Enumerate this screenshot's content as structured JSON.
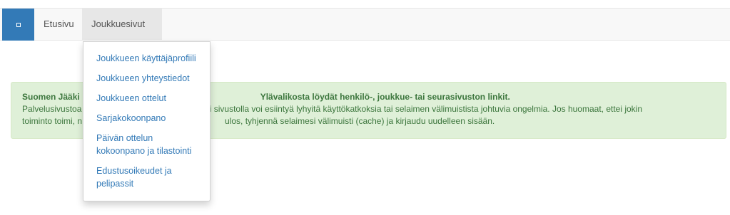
{
  "navbar": {
    "brand_icon": "square-icon",
    "home_label": "Etusivu",
    "team_label": "Joukkuesivut"
  },
  "dropdown": {
    "items": [
      "Joukkueen käyttäjäprofiili",
      "Joukkueen yhteystiedot",
      "Joukkueen ottelut",
      "Sarjakokoonpano",
      "Päivän ottelun kokoonpano ja tilastointi",
      "Edustusoikeudet ja pelipassit"
    ]
  },
  "alert": {
    "title_start": "Suomen Jääki",
    "title_end": "Ylävalikosta löydät henkilö-, joukkue- tai seurasivuston linkit.",
    "line2_start": "Palvelusivustoa",
    "line2_end": "uoksi sivustolla voi esiintyä lyhyitä käyttökatkoksia tai selaimen välimuistista johtuvia ongelmia. Jos huomaat, ettei jokin",
    "line3_start": "toiminto toimi, n",
    "line3_end": "ulos, tyhjennä selaimesi välimuisti (cache) ja kirjaudu uudelleen sisään."
  },
  "colors": {
    "brand": "#337ab7",
    "navbar_bg": "#f8f8f8",
    "alert_bg": "#dff0d8",
    "alert_text": "#3c763d",
    "link": "#337ab7"
  }
}
